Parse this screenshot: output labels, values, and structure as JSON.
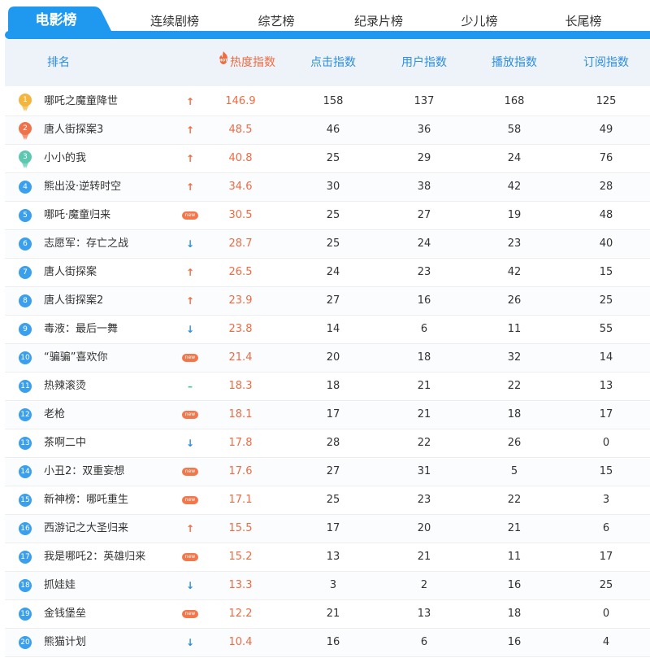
{
  "tabs": [
    {
      "label": "电影榜",
      "active": true
    },
    {
      "label": "连续剧榜",
      "active": false
    },
    {
      "label": "综艺榜",
      "active": false
    },
    {
      "label": "纪录片榜",
      "active": false
    },
    {
      "label": "少儿榜",
      "active": false
    },
    {
      "label": "长尾榜",
      "active": false
    }
  ],
  "table": {
    "headers": {
      "rank": "排名",
      "hot_badge": "HOT",
      "hot": "热度指数",
      "click": "点击指数",
      "user": "用户指数",
      "play": "播放指数",
      "subscribe": "订阅指数"
    },
    "new_badge_text": "new",
    "rows": [
      {
        "rank": "1",
        "medal": "gold",
        "title": "哪吒之魔童降世",
        "trend": "up",
        "hot": "146.9",
        "click": "158",
        "user": "137",
        "play": "168",
        "subscribe": "125"
      },
      {
        "rank": "2",
        "medal": "red",
        "title": "唐人街探案3",
        "trend": "up",
        "hot": "48.5",
        "click": "46",
        "user": "36",
        "play": "58",
        "subscribe": "49"
      },
      {
        "rank": "3",
        "medal": "teal",
        "title": "小小的我",
        "trend": "up",
        "hot": "40.8",
        "click": "25",
        "user": "29",
        "play": "24",
        "subscribe": "76"
      },
      {
        "rank": "4",
        "title": "熊出没·逆转时空",
        "trend": "up",
        "hot": "34.6",
        "click": "30",
        "user": "38",
        "play": "42",
        "subscribe": "28"
      },
      {
        "rank": "5",
        "title": "哪吒·魔童归来",
        "trend": "new",
        "hot": "30.5",
        "click": "25",
        "user": "27",
        "play": "19",
        "subscribe": "48"
      },
      {
        "rank": "6",
        "title": "志愿军：存亡之战",
        "trend": "down",
        "hot": "28.7",
        "click": "25",
        "user": "24",
        "play": "23",
        "subscribe": "40"
      },
      {
        "rank": "7",
        "title": "唐人街探案",
        "trend": "up",
        "hot": "26.5",
        "click": "24",
        "user": "23",
        "play": "42",
        "subscribe": "15"
      },
      {
        "rank": "8",
        "title": "唐人街探案2",
        "trend": "up",
        "hot": "23.9",
        "click": "27",
        "user": "16",
        "play": "26",
        "subscribe": "25"
      },
      {
        "rank": "9",
        "title": "毒液：最后一舞",
        "trend": "down",
        "hot": "23.8",
        "click": "14",
        "user": "6",
        "play": "11",
        "subscribe": "55"
      },
      {
        "rank": "10",
        "title": "“骗骗”喜欢你",
        "trend": "new",
        "hot": "21.4",
        "click": "20",
        "user": "18",
        "play": "32",
        "subscribe": "14"
      },
      {
        "rank": "11",
        "title": "热辣滚烫",
        "trend": "flat",
        "hot": "18.3",
        "click": "18",
        "user": "21",
        "play": "22",
        "subscribe": "13"
      },
      {
        "rank": "12",
        "title": "老枪",
        "trend": "new",
        "hot": "18.1",
        "click": "17",
        "user": "21",
        "play": "18",
        "subscribe": "17"
      },
      {
        "rank": "13",
        "title": "茶啊二中",
        "trend": "down",
        "hot": "17.8",
        "click": "28",
        "user": "22",
        "play": "26",
        "subscribe": "0"
      },
      {
        "rank": "14",
        "title": "小丑2：双重妄想",
        "trend": "new",
        "hot": "17.6",
        "click": "27",
        "user": "31",
        "play": "5",
        "subscribe": "15"
      },
      {
        "rank": "15",
        "title": "新神榜：哪吒重生",
        "trend": "new",
        "hot": "17.1",
        "click": "25",
        "user": "23",
        "play": "22",
        "subscribe": "3"
      },
      {
        "rank": "16",
        "title": "西游记之大圣归来",
        "trend": "up",
        "hot": "15.5",
        "click": "17",
        "user": "20",
        "play": "21",
        "subscribe": "6"
      },
      {
        "rank": "17",
        "title": "我是哪吒2：英雄归来",
        "trend": "new",
        "hot": "15.2",
        "click": "13",
        "user": "21",
        "play": "11",
        "subscribe": "17"
      },
      {
        "rank": "18",
        "title": "抓娃娃",
        "trend": "down",
        "hot": "13.3",
        "click": "3",
        "user": "2",
        "play": "16",
        "subscribe": "25"
      },
      {
        "rank": "19",
        "title": "金钱堡垒",
        "trend": "new",
        "hot": "12.2",
        "click": "21",
        "user": "13",
        "play": "18",
        "subscribe": "0"
      },
      {
        "rank": "20",
        "title": "熊猫计划",
        "trend": "down",
        "hot": "10.4",
        "click": "16",
        "user": "6",
        "play": "16",
        "subscribe": "4"
      }
    ]
  },
  "colors": {
    "accent_blue": "#1f98f0",
    "header_text_blue": "#2e8ede",
    "hot_orange": "#f06b42",
    "down_blue": "#2e8ede",
    "flat_teal": "#46c2a5",
    "medal_gold": "#f5b53d",
    "medal_red": "#f0724a",
    "medal_teal": "#5cc8b0",
    "rank_blue": "#3aa0ee"
  },
  "icons": {
    "up": "arrow-up-icon",
    "down": "arrow-down-icon",
    "flat": "flat-dash-icon",
    "new": "new-badge",
    "hot": "flame-hot-icon",
    "medal": "medal-icon"
  }
}
